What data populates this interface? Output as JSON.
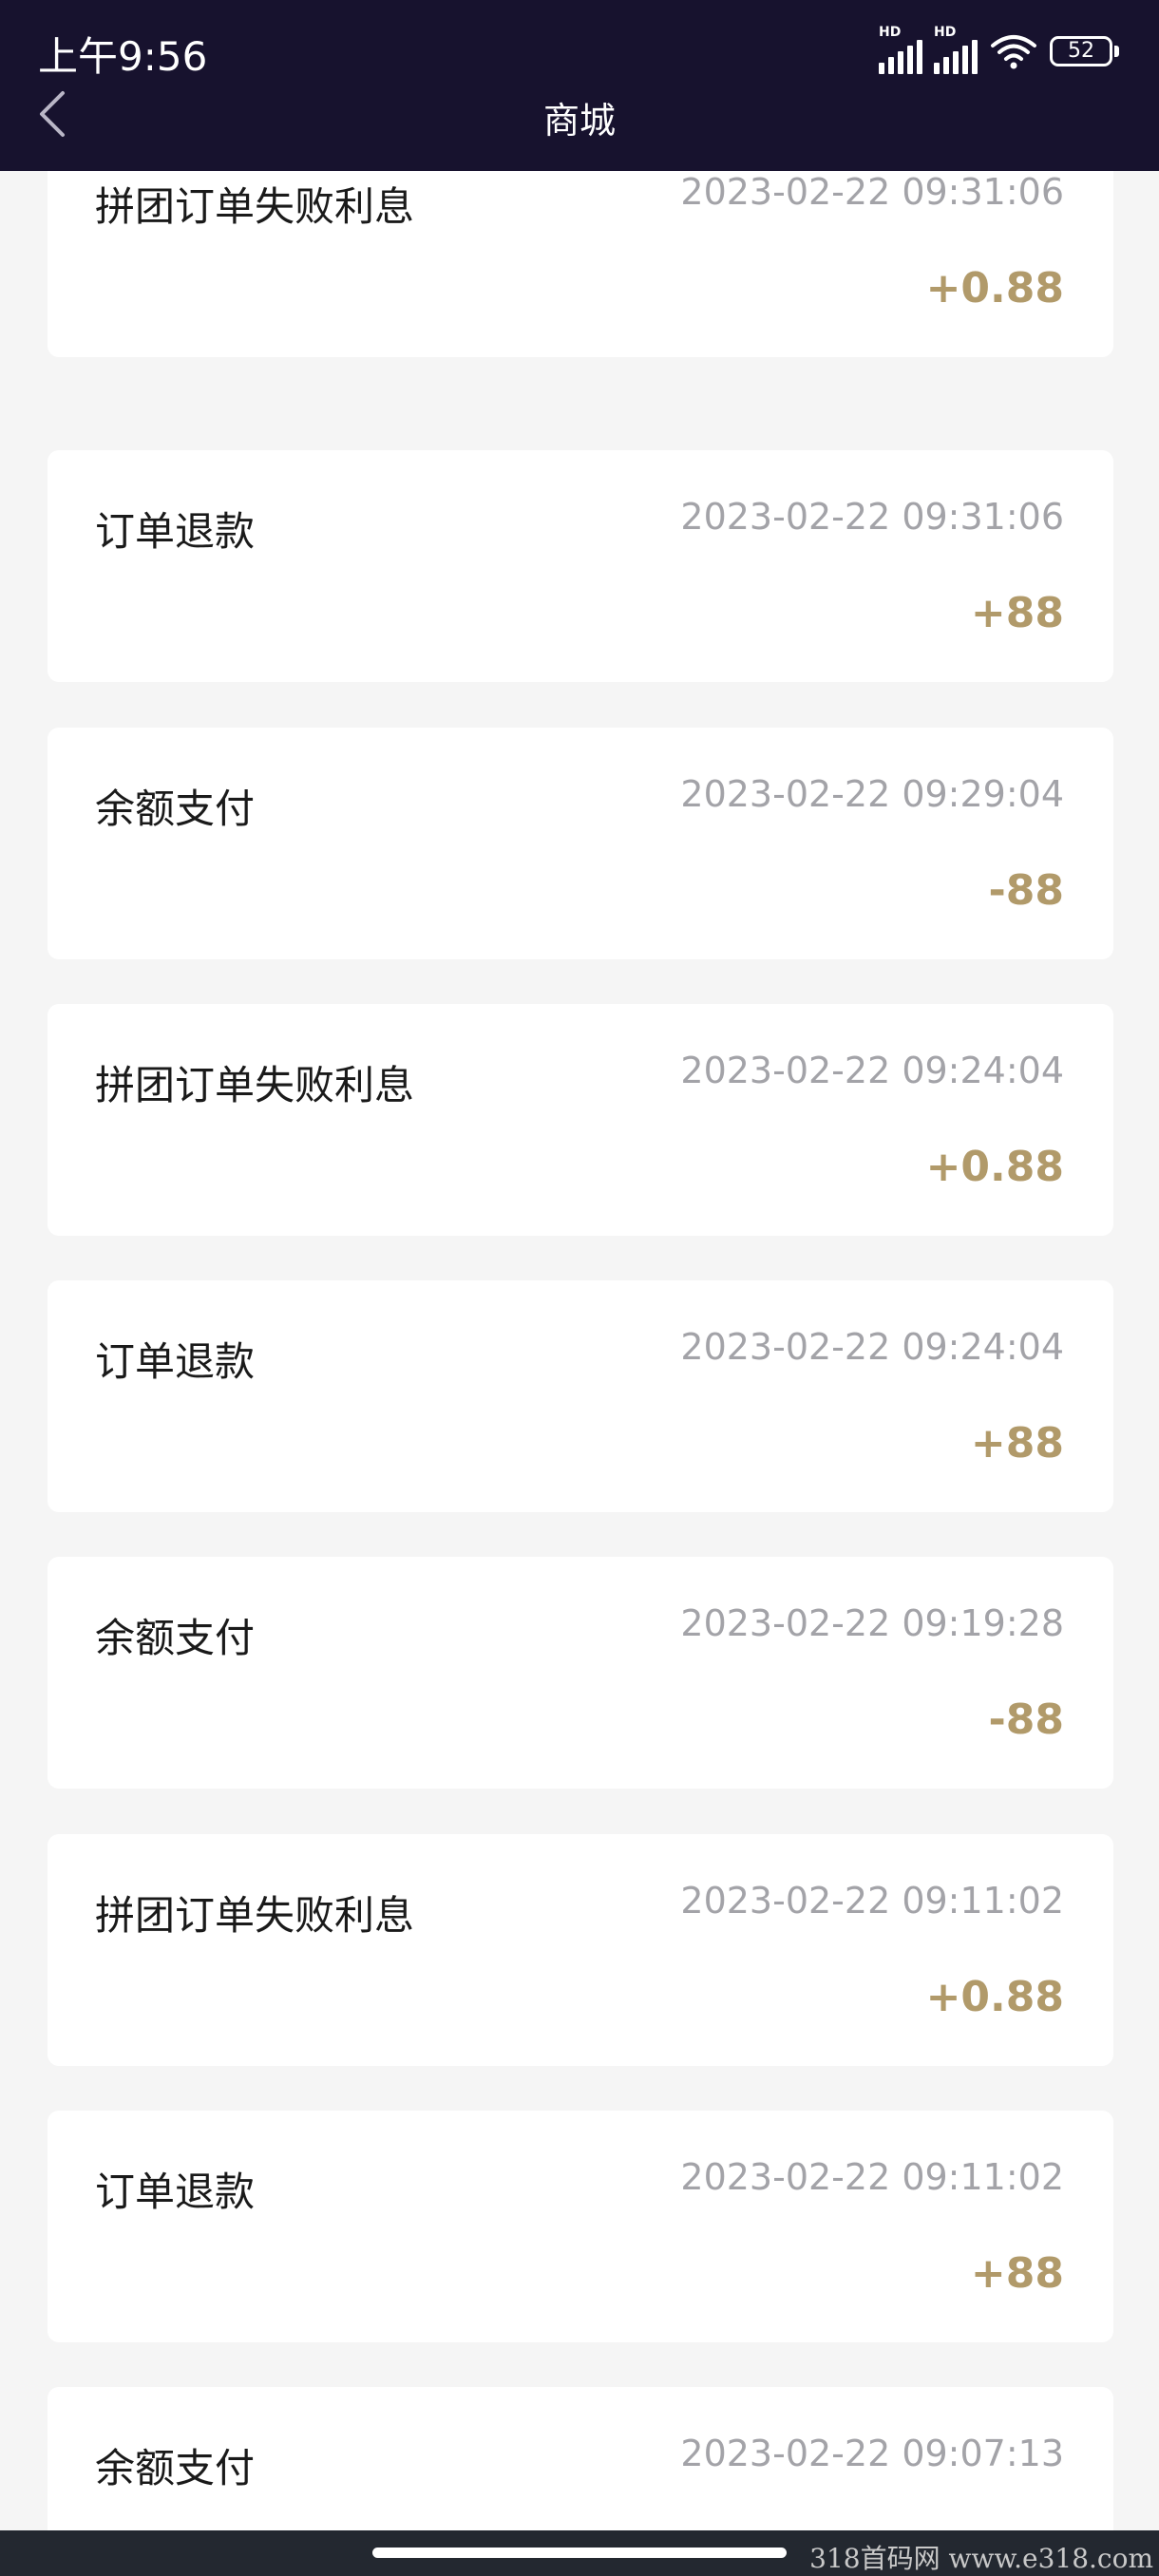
{
  "status_bar": {
    "time": "上午9:56",
    "signal_1_label": "HD",
    "signal_2_label": "HD",
    "battery_level": "52"
  },
  "header": {
    "title": "商城"
  },
  "records": [
    {
      "title": "拼团订单失败利息",
      "time": "2023-02-22 09:31:06",
      "amount": "+0.88"
    },
    {
      "title": "订单退款",
      "time": "2023-02-22 09:31:06",
      "amount": "+88"
    },
    {
      "title": "余额支付",
      "time": "2023-02-22 09:29:04",
      "amount": "-88"
    },
    {
      "title": "拼团订单失败利息",
      "time": "2023-02-22 09:24:04",
      "amount": "+0.88"
    },
    {
      "title": "订单退款",
      "time": "2023-02-22 09:24:04",
      "amount": "+88"
    },
    {
      "title": "余额支付",
      "time": "2023-02-22 09:19:28",
      "amount": "-88"
    },
    {
      "title": "拼团订单失败利息",
      "time": "2023-02-22 09:11:02",
      "amount": "+0.88"
    },
    {
      "title": "订单退款",
      "time": "2023-02-22 09:11:02",
      "amount": "+88"
    },
    {
      "title": "余额支付",
      "time": "2023-02-22 09:07:13",
      "amount": ""
    }
  ],
  "watermark": "318首码网  www.e318.com",
  "colors": {
    "header_bg": "#17122e",
    "amount": "#b19a6a",
    "time": "#a3a3a8",
    "page_bg": "#f5f5f5"
  }
}
